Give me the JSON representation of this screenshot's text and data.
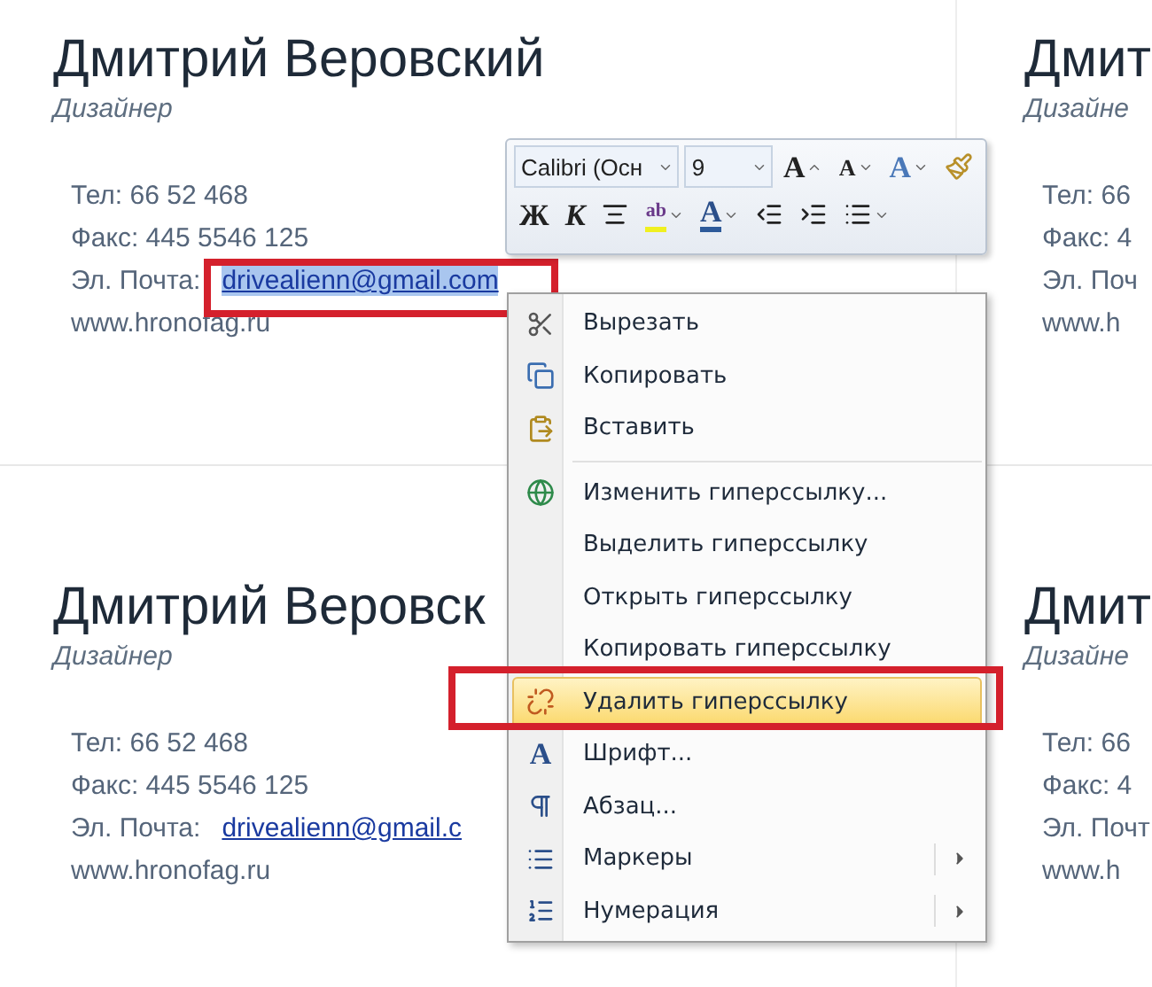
{
  "cards": [
    {
      "name": "Дмитрий Веровский",
      "role": "Дизайнер",
      "phone": "Тел: 66 52 468",
      "fax": "Факс:  445 5546 125",
      "email_label": "Эл. Почта:",
      "email": {
        "text": "drivealienn@gmail.com",
        "selected": true
      },
      "site": "www.hronofag.ru"
    },
    {
      "name": "Дмит",
      "role": "Дизайне",
      "phone": "Тел: 66",
      "fax": "Факс:  4",
      "email_label": "Эл. Поч",
      "site": "www.h"
    },
    {
      "name": "Дмитрий Веровск",
      "role": "Дизайнер",
      "phone": "Тел: 66 52 468",
      "fax": "Факс:  445 5546 125",
      "email_label": "Эл. Почта:",
      "email": {
        "text": "drivealienn@gmail.c",
        "selected": false
      },
      "site": "www.hronofag.ru"
    },
    {
      "name": "Дмит",
      "role": "Дизайне",
      "phone": "Тел: 66",
      "fax": "Факс:  4",
      "email_label": "Эл. Почт",
      "site": "www.h"
    }
  ],
  "mini_toolbar": {
    "font": "Calibri (Осн",
    "size": "9",
    "row_1": [
      {
        "kind": "grow",
        "label": "A"
      },
      {
        "kind": "shrink",
        "label": "A"
      },
      {
        "kind": "styles",
        "label": "A"
      },
      {
        "kind": "painter"
      }
    ],
    "row_2": [
      {
        "kind": "bold",
        "label": "Ж"
      },
      {
        "kind": "italic",
        "label": "К"
      },
      {
        "kind": "center"
      },
      {
        "kind": "highlight",
        "label": "ab"
      },
      {
        "kind": "fontcolor",
        "label": "A"
      },
      {
        "kind": "outdent"
      },
      {
        "kind": "indent"
      },
      {
        "kind": "bullets"
      }
    ]
  },
  "context_menu": [
    {
      "kind": "cut",
      "label": "Вырезать",
      "highlighted": false
    },
    {
      "kind": "copy",
      "label": "Копировать",
      "highlighted": false
    },
    {
      "kind": "paste",
      "label": "Вставить",
      "highlighted": false
    },
    {
      "kind": "separator"
    },
    {
      "kind": "link",
      "label": "Изменить гиперссылку...",
      "highlighted": false
    },
    {
      "kind": "plain",
      "label": "Выделить гиперссылку",
      "highlighted": false
    },
    {
      "kind": "plain",
      "label": "Открыть гиперссылку",
      "highlighted": false
    },
    {
      "kind": "plain",
      "label": "Копировать гиперссылку",
      "highlighted": false
    },
    {
      "kind": "unlink",
      "label": "Удалить гиперссылку",
      "highlighted": true
    },
    {
      "kind": "font",
      "glyph": "A",
      "label": "Шрифт...",
      "highlighted": false
    },
    {
      "kind": "paragraph",
      "label": "Абзац...",
      "highlighted": false
    },
    {
      "kind": "bullets",
      "label": "Маркеры",
      "highlighted": false,
      "submenu": true
    },
    {
      "kind": "numbering",
      "label": "Нумерация",
      "highlighted": false,
      "submenu": true
    }
  ]
}
